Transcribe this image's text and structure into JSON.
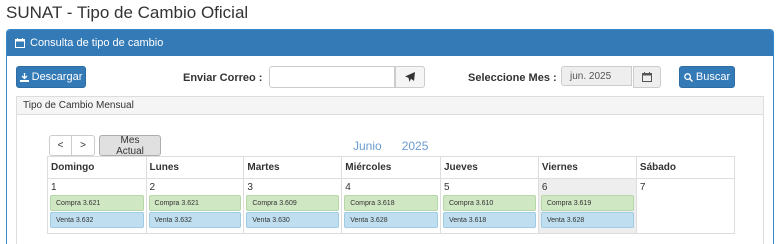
{
  "page": {
    "title": "SUNAT - Tipo de Cambio Oficial"
  },
  "panel": {
    "heading": "Consulta de tipo de cambio"
  },
  "toolbar": {
    "download_label": "Descargar",
    "email_label": "Enviar Correo :",
    "email_value": "",
    "month_label": "Seleccione Mes :",
    "month_value": "jun. 2025",
    "search_label": "Buscar"
  },
  "calendar": {
    "panel_title": "Tipo de Cambio Mensual",
    "prev_label": "<",
    "next_label": ">",
    "today_label": "Mes Actual",
    "month": "Junio",
    "year": "2025",
    "weekdays": [
      "Domingo",
      "Lunes",
      "Martes",
      "Miércoles",
      "Jueves",
      "Viernes",
      "Sábado"
    ],
    "days": [
      {
        "day": "1",
        "compra": "Compra 3.621",
        "venta": "Venta 3.632"
      },
      {
        "day": "2",
        "compra": "Compra 3.621",
        "venta": "Venta 3.632"
      },
      {
        "day": "3",
        "compra": "Compra 3.609",
        "venta": "Venta 3.630"
      },
      {
        "day": "4",
        "compra": "Compra 3.618",
        "venta": "Venta 3.628"
      },
      {
        "day": "5",
        "compra": "Compra 3.610",
        "venta": "Venta 3.618"
      },
      {
        "day": "6",
        "compra": "Compra 3.619",
        "venta": "Venta 3.628"
      },
      {
        "day": "7",
        "compra": "",
        "venta": ""
      }
    ]
  },
  "colors": {
    "primary": "#337ab7",
    "compra": "#cfe7c2",
    "venta": "#bfdff0",
    "month_title": "#6b9bd1"
  }
}
